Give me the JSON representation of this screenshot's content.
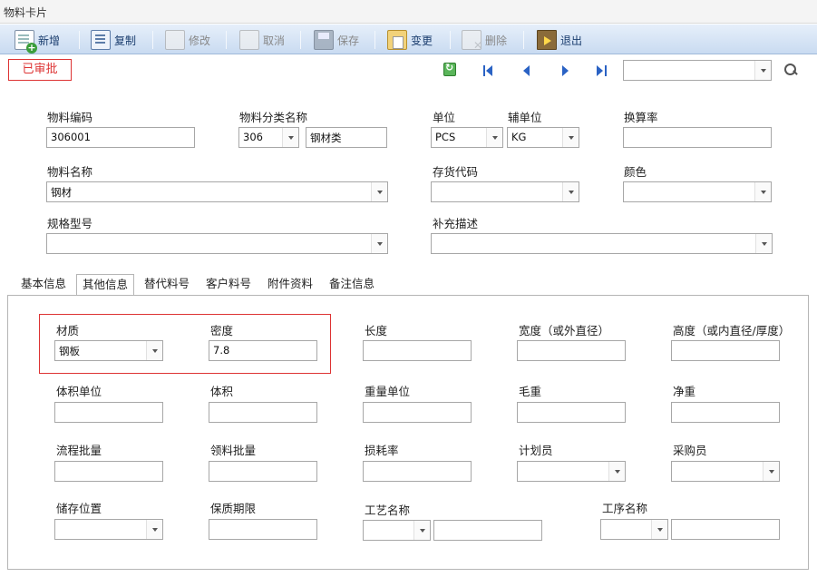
{
  "window": {
    "title": "物料卡片"
  },
  "toolbar": {
    "new": "新增",
    "copy": "复制",
    "edit": "修改",
    "cancel": "取消",
    "save": "保存",
    "change": "变更",
    "delete": "删除",
    "exit": "退出"
  },
  "status": {
    "badge": "已审批",
    "record_selector": ""
  },
  "header": {
    "code_label": "物料编码",
    "code_value": "306001",
    "category_label": "物料分类名称",
    "category_code": "306",
    "category_name": "钢材类",
    "unit_label": "单位",
    "unit_value": "PCS",
    "aux_unit_label": "辅单位",
    "aux_unit_value": "KG",
    "rate_label": "换算率",
    "rate_value": "",
    "name_label": "物料名称",
    "name_value": "钢材",
    "inventory_label": "存货代码",
    "inventory_value": "",
    "color_label": "颜色",
    "color_value": "",
    "spec_label": "规格型号",
    "spec_value": "",
    "desc_label": "补充描述",
    "desc_value": ""
  },
  "tabs": [
    "基本信息",
    "其他信息",
    "替代料号",
    "客户料号",
    "附件资料",
    "备注信息"
  ],
  "other": {
    "material_label": "材质",
    "material_value": "钢板",
    "density_label": "密度",
    "density_value": "7.8",
    "length_label": "长度",
    "length_value": "",
    "width_label": "宽度（或外直径）",
    "width_value": "",
    "height_label": "高度（或内直径/厚度）",
    "height_value": "",
    "volume_unit_label": "体积单位",
    "volume_unit_value": "",
    "volume_label": "体积",
    "volume_value": "",
    "weight_unit_label": "重量单位",
    "weight_unit_value": "",
    "gross_label": "毛重",
    "gross_value": "",
    "net_label": "净重",
    "net_value": "",
    "flow_batch_label": "流程批量",
    "flow_batch_value": "",
    "pick_batch_label": "领料批量",
    "pick_batch_value": "",
    "loss_label": "损耗率",
    "loss_value": "",
    "planner_label": "计划员",
    "planner_value": "",
    "buyer_label": "采购员",
    "buyer_value": "",
    "storage_label": "储存位置",
    "storage_value": "",
    "shelf_label": "保质期限",
    "shelf_value": "",
    "process_label": "工艺名称",
    "process_code": "",
    "process_name": "",
    "operation_label": "工序名称",
    "operation_code": "",
    "operation_name": ""
  }
}
